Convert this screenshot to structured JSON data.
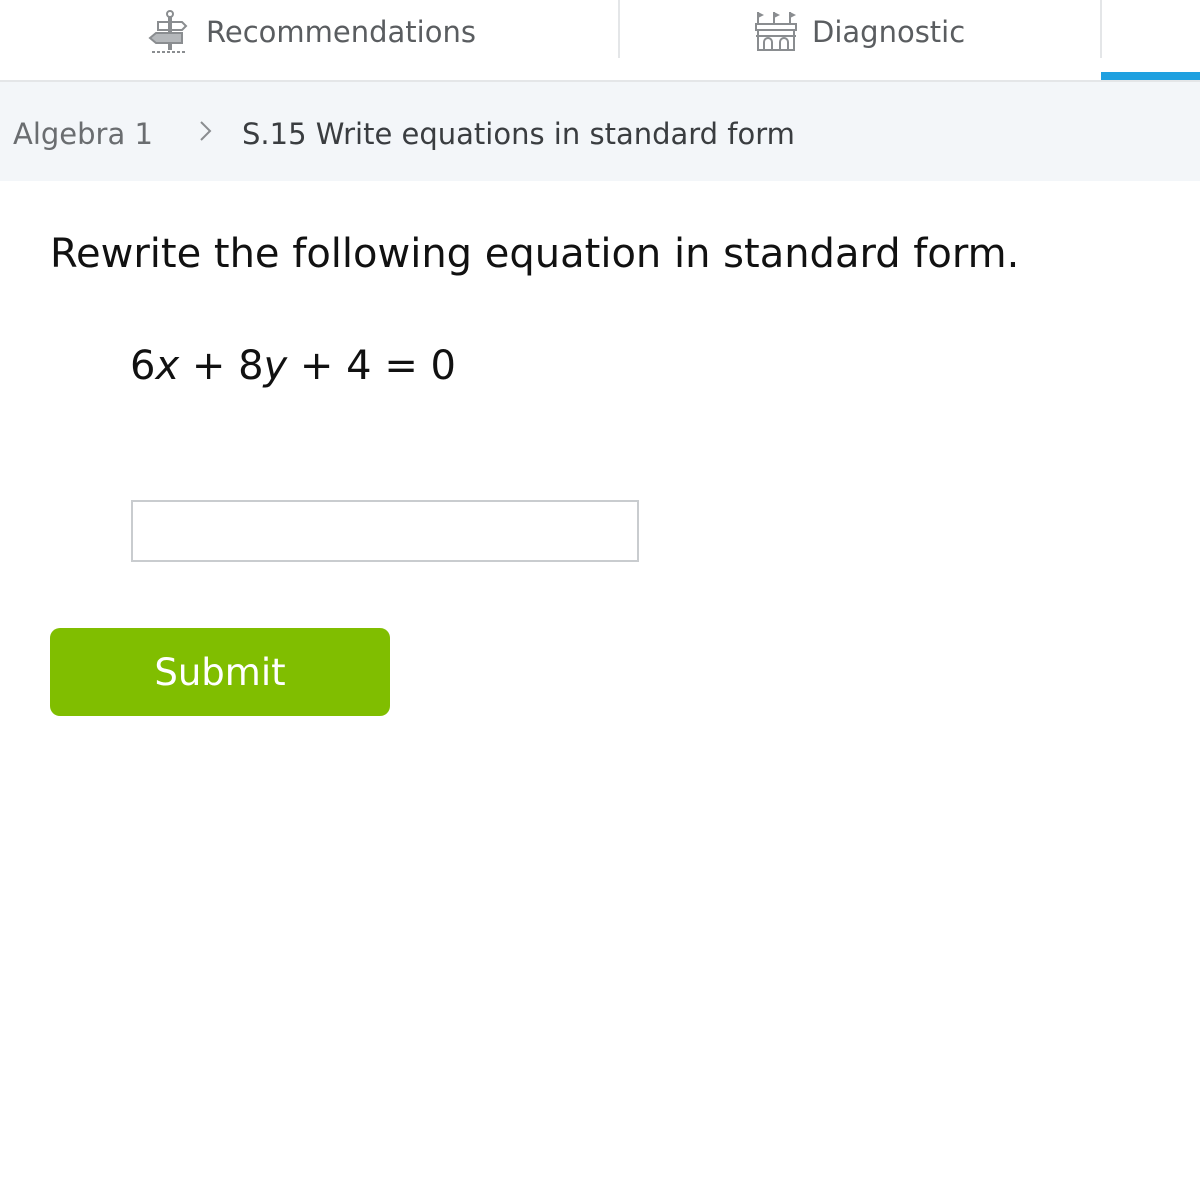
{
  "nav": {
    "tabs": [
      {
        "label": "Recommendations",
        "icon": "signpost-icon"
      },
      {
        "label": "Diagnostic",
        "icon": "castle-icon"
      }
    ],
    "accent_color": "#1ea0e0"
  },
  "breadcrumb": {
    "course": "Algebra 1",
    "skill": "S.15 Write equations in standard form"
  },
  "question": {
    "prompt": "Rewrite the following equation in standard form.",
    "equation": {
      "coef_x": "6",
      "var_x": "x",
      "plus1": " + ",
      "coef_y": "8",
      "var_y": "y",
      "rest": " + 4 = 0"
    }
  },
  "answer": {
    "value": "",
    "placeholder": ""
  },
  "submit": {
    "label": "Submit",
    "color": "#80be00"
  }
}
